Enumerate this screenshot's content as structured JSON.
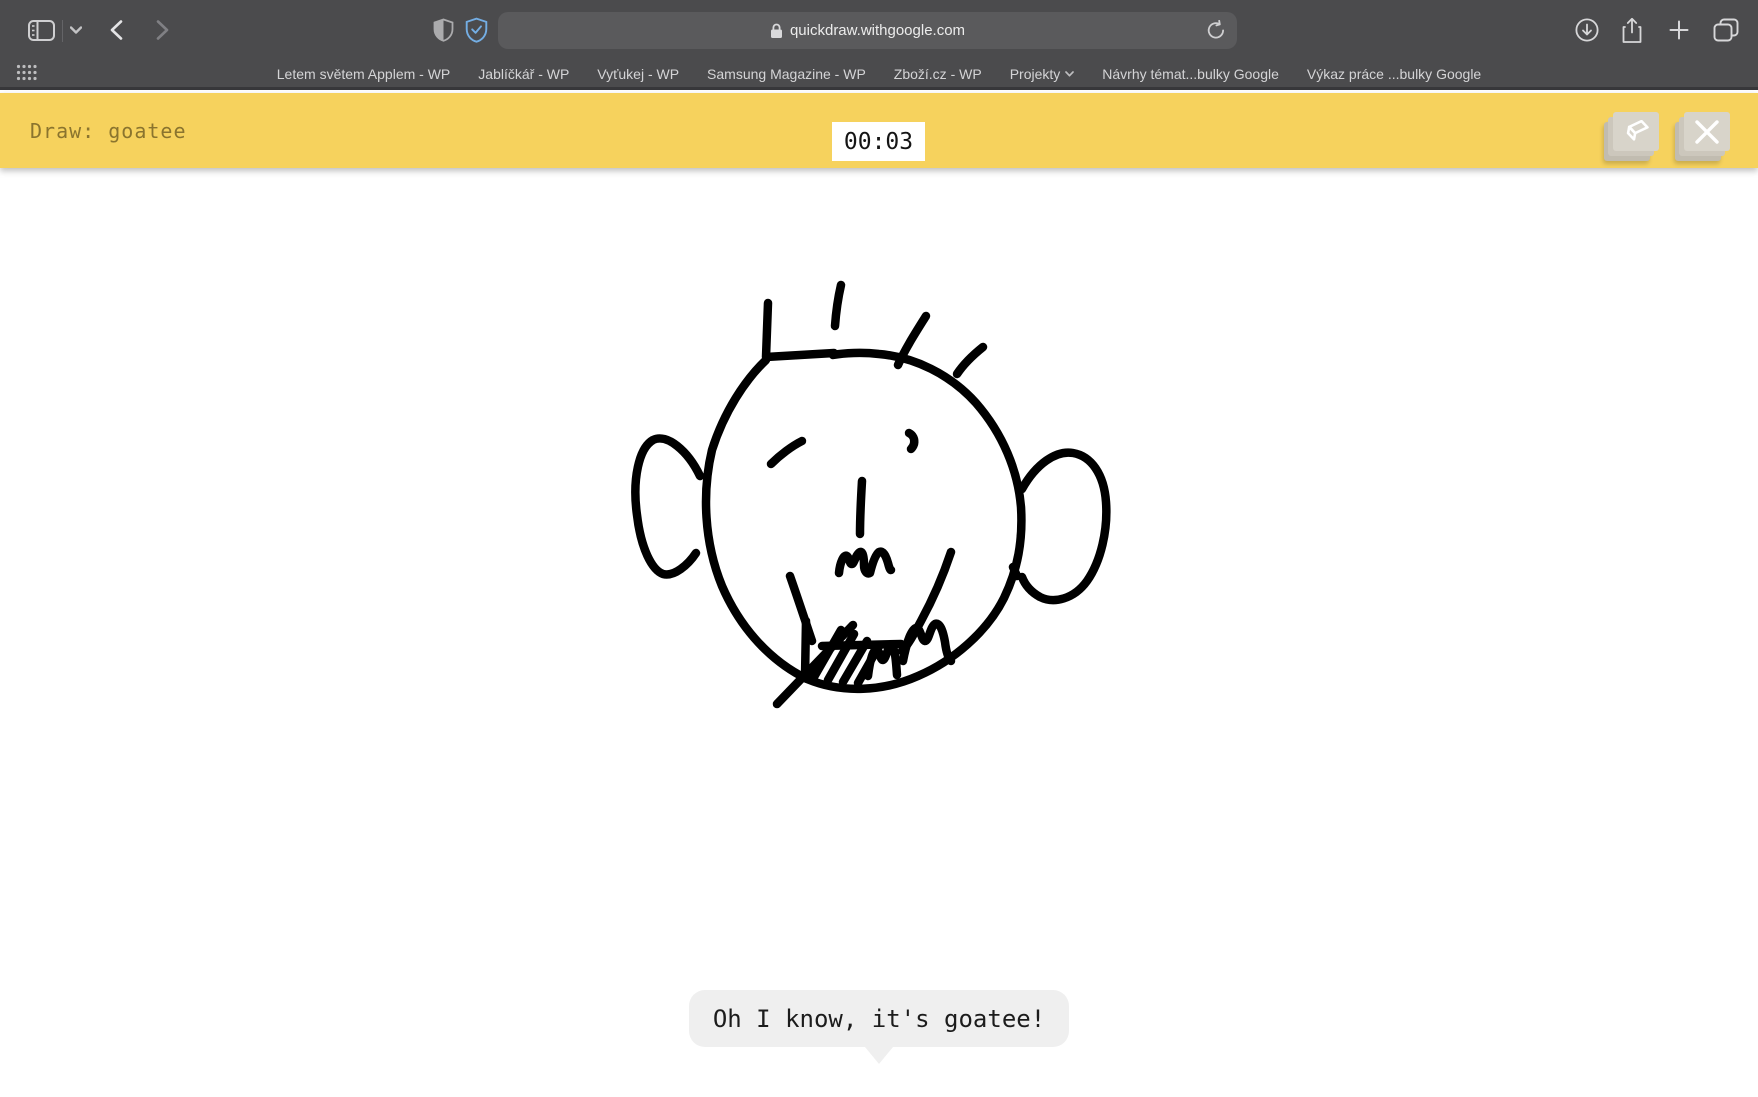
{
  "browser": {
    "url": "quickdraw.withgoogle.com",
    "bookmarks": [
      "Letem světem Applem - WP",
      "Jablíčkář - WP",
      "Vyťukej - WP",
      "Samsung Magazine - WP",
      "Zboží.cz - WP",
      "Projekty",
      "Návrhy témat...bulky Google",
      "Výkaz práce ...bulky Google"
    ]
  },
  "game": {
    "prompt": "Draw: goatee",
    "timer": "00:03",
    "guess": "Oh I know, it's goatee!"
  },
  "colors": {
    "header_yellow": "#f6d25d",
    "chrome_gray": "#4b4b4d",
    "prompt_text": "#8a742e",
    "key_face": "#d8d4ca",
    "bubble_gray": "#efefef",
    "ink": "#000000"
  },
  "drawing": {
    "strokes": [
      "M766,360 C745,380 724,412 712,450 C702,492 704,542 722,586 C741,630 772,662 807,679 C843,694 884,691 918,676 C953,661 987,632 1004,598 C1018,569 1023,540 1021,507 C1018,471 1003,434 976,403 C950,374 914,357 879,354 C862,352 844,353 833,355",
      "M768,303 L766,357 L834,353",
      "M841,285 C838,298 836,312 835,326",
      "M926,316 C916,332 905,349 898,365",
      "M983,347 C973,355 963,365 957,374",
      "M700,476 C688,451 667,433 653,440 C639,448 632,479 637,515 C641,549 652,570 663,574 C674,577 688,565 696,553",
      "M1022,489 C1036,464 1056,450 1073,453 C1091,456 1104,474 1106,502 C1108,530 1101,561 1087,581 C1074,599 1054,604 1040,597 C1031,592 1025,585 1022,577",
      "M1013,567 L1017,576",
      "M771,464 C780,455 792,446 802,441",
      "M909,433 C913,435 915,439 914,444 C913,447 912,448 911,449",
      "M862,481 C861,498 860,516 860,534",
      "M839,573 C840,562 844,554 847,556 C850,558 849,564 852,564 C854,564 856,554 860,552 C863,551 864,558 864,565 C864,571 867,575 870,573 C872,565 875,555 879,552 C883,550 886,556 888,563 C889,567 890,570 891,570",
      "M790,576 C797,596 805,620 812,641",
      "M806,621 L805,678",
      "M814,677 L841,630",
      "M828,680 L854,634",
      "M843,682 L867,641",
      "M858,683 L879,646",
      "M822,646 L901,644",
      "M777,704 L853,625",
      "M868,676 C870,660 873,649 877,650 C880,651 880,660 883,660 C886,659 887,648 891,647 C895,647 896,660 897,675",
      "M951,552 C944,573 933,599 921,621 C914,634 908,645 902,651",
      "M903,661 C906,645 911,629 916,628 C921,628 921,640 925,641 C929,641 930,627 935,624 C940,622 943,631 945,642 C946,650 948,658 951,661"
    ]
  }
}
